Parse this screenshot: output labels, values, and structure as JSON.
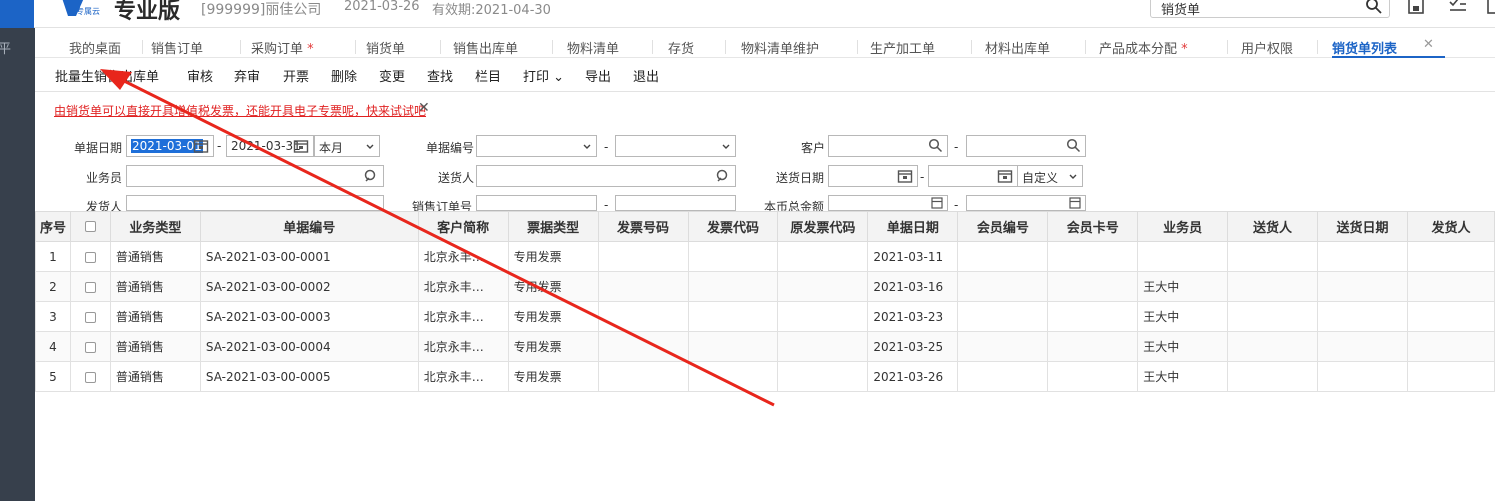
{
  "header": {
    "logo_sub": "专属云",
    "edition": "专业版",
    "company": "[999999]丽佳公司",
    "date": "2021-03-26",
    "validity": "有效期:2021-04-30",
    "search_value": "销货单"
  },
  "sidebar": {
    "text": "平"
  },
  "tabs": [
    {
      "label": "我的桌面"
    },
    {
      "label": "销售订单"
    },
    {
      "label": "采购订单",
      "star": "*"
    },
    {
      "label": "销货单"
    },
    {
      "label": "销售出库单"
    },
    {
      "label": "物料清单"
    },
    {
      "label": "存货"
    },
    {
      "label": "物料清单维护"
    },
    {
      "label": "生产加工单"
    },
    {
      "label": "材料出库单"
    },
    {
      "label": "产品成本分配",
      "star": "*"
    },
    {
      "label": "用户权限"
    },
    {
      "label": "销货单列表"
    }
  ],
  "tab_close": "✕",
  "toolbar": [
    "批量生销售出库单",
    "审核",
    "弃审",
    "开票",
    "删除",
    "变更",
    "查找",
    "栏目",
    "打印",
    "导出",
    "退出"
  ],
  "print_caret": "⌄",
  "notice": {
    "text": "由销货单可以直接开具增值税发票，还能开具电子专票呢，快来试试吧",
    "close": "✕"
  },
  "form": {
    "date_label": "单据日期",
    "date_from": "2021-03-01",
    "date_to": "2021-03-31",
    "period": "本月",
    "doc_no_label": "单据编号",
    "customer_label": "客户",
    "salesman_label": "业务员",
    "deliverer_label": "送货人",
    "delivery_date_label": "送货日期",
    "delivery_period": "自定义",
    "shipper_label": "发货人",
    "sales_order_label": "销售订单号",
    "total_amount_label": "本币总金额",
    "dash": "-"
  },
  "table": {
    "headers": [
      "序号",
      "",
      "业务类型",
      "单据编号",
      "客户简称",
      "票据类型",
      "发票号码",
      "发票代码",
      "原发票代码",
      "单据日期",
      "会员编号",
      "会员卡号",
      "业务员",
      "送货人",
      "送货日期",
      "发货人"
    ],
    "rows": [
      [
        "1",
        "",
        "普通销售",
        "SA-2021-03-00-0001",
        "北京永丰…",
        "专用发票",
        "",
        "",
        "",
        "2021-03-11",
        "",
        "",
        "",
        "",
        "",
        ""
      ],
      [
        "2",
        "",
        "普通销售",
        "SA-2021-03-00-0002",
        "北京永丰…",
        "专用发票",
        "",
        "",
        "",
        "2021-03-16",
        "",
        "",
        "王大中",
        "",
        "",
        ""
      ],
      [
        "3",
        "",
        "普通销售",
        "SA-2021-03-00-0003",
        "北京永丰…",
        "专用发票",
        "",
        "",
        "",
        "2021-03-23",
        "",
        "",
        "王大中",
        "",
        "",
        ""
      ],
      [
        "4",
        "",
        "普通销售",
        "SA-2021-03-00-0004",
        "北京永丰…",
        "专用发票",
        "",
        "",
        "",
        "2021-03-25",
        "",
        "",
        "王大中",
        "",
        "",
        ""
      ],
      [
        "5",
        "",
        "普通销售",
        "SA-2021-03-00-0005",
        "北京永丰…",
        "专用发票",
        "",
        "",
        "",
        "2021-03-26",
        "",
        "",
        "王大中",
        "",
        "",
        ""
      ]
    ]
  },
  "colors": {
    "accent": "#1c64c6",
    "sidebar": "#37404c",
    "notice": "#e02222",
    "annotation_arrow": "#e8261c"
  },
  "icons": {
    "search": "search-icon",
    "calendar": "calendar-icon",
    "save": "save-icon",
    "calculator": "calculator-icon"
  }
}
